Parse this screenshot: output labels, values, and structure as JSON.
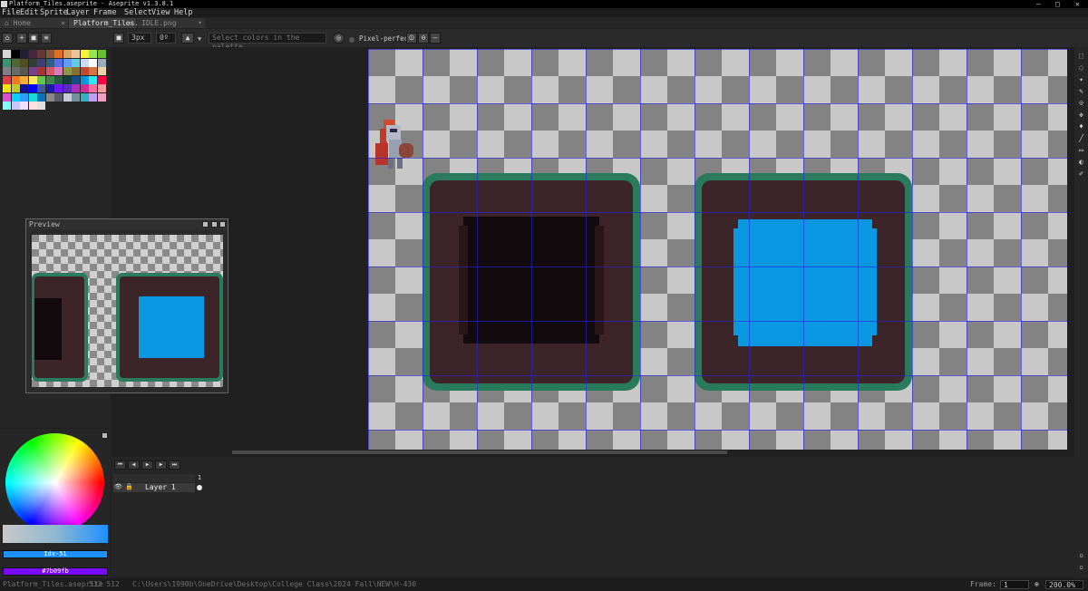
{
  "window": {
    "title": "Platform_Tiles.aseprite - Aseprite v1.3.8.1",
    "controls": [
      "–",
      "□",
      "✕"
    ]
  },
  "menu": [
    "File",
    "Edit",
    "Sprite",
    "Layer",
    "Frame",
    "Select",
    "View",
    "Help"
  ],
  "tabs": [
    {
      "label": "Home",
      "active": false
    },
    {
      "label": "Platform_Tiles.",
      "active": true
    },
    {
      "label": "IDLE.png",
      "active": false
    }
  ],
  "toolbar": {
    "brush_size": "3px",
    "brush_angle": "0º",
    "palette_placeholder": "Select colors in the palette",
    "pixel_perfect_label": "Pixel-perfect"
  },
  "preview": {
    "title": "Preview"
  },
  "palette": {
    "rows": [
      [
        "#d7d7d7",
        "#000000",
        "#222034",
        "#45283c",
        "#663931",
        "#8f563b",
        "#df7126",
        "#d9a066",
        "#eec39a",
        "#fbf236",
        "#99e550",
        "#6abe30"
      ],
      [
        "#37946e",
        "#4b692f",
        "#524b24",
        "#323c39",
        "#3f3f74",
        "#306082",
        "#5b6ee1",
        "#639bff",
        "#5fcde4",
        "#cbdbfc",
        "#ffffff",
        "#9badb7"
      ],
      [
        "#847e87",
        "#696a6a",
        "#595652",
        "#76428a",
        "#ac3232",
        "#d95763",
        "#d77bba",
        "#8f974a",
        "#8a6f30",
        "#be4a2f",
        "#d77643",
        "#ead4aa"
      ],
      [
        "#e43b44",
        "#f77622",
        "#feae34",
        "#fee761",
        "#63c74d",
        "#3e8948",
        "#265c42",
        "#193c3e",
        "#124e89",
        "#0099db",
        "#2ce8f5",
        "#ff0044"
      ],
      [
        "#ffe500",
        "#c0cb24",
        "#0f0f8f",
        "#0000ff",
        "#3c5a9a",
        "#1b1ba4",
        "#6a1bff",
        "#5a2bbf",
        "#b12bbf",
        "#d42b9c",
        "#ff6e9e",
        "#fe9b9b"
      ],
      [
        "#e04ad4",
        "#0ad0ff",
        "#29a0ff",
        "#1ad8d8",
        "#0a70bf",
        "#8a8a8a",
        "#5a5a6a",
        "#c8c8d8",
        "#7090a0",
        "#30b0c0",
        "#c0a0f0",
        "#f0a0c0"
      ],
      [
        "#7ffaff",
        "#c7c7ff",
        "#f0e0ff",
        "#ffe0e0",
        "#e0e0e0"
      ]
    ]
  },
  "color_panel": {
    "primary_label": "Idx-51",
    "secondary_label": "#7b09fb",
    "primary_color": "#1e90ff",
    "secondary_color": "#7b09fb"
  },
  "timeline": {
    "frame_number": "1",
    "layer_name": "Layer 1"
  },
  "status": {
    "file": "Platform_Tiles.aseprite",
    "size": "512 512",
    "path": "C:\\Users\\1990b\\OneDrive\\Desktop\\College Class\\2024 Fall\\NEW\\H-430",
    "frame_label": "Frame:",
    "frame_value": "1",
    "zoom": "200.0%"
  },
  "colors": {
    "checker_light": "#c8c8c8",
    "checker_dark": "#828282",
    "grid": "#1a1adc",
    "dirt": "#3a2326",
    "dirt_dark": "#120a0c",
    "grass": "#2d7a62",
    "water": "#0a98e2"
  }
}
